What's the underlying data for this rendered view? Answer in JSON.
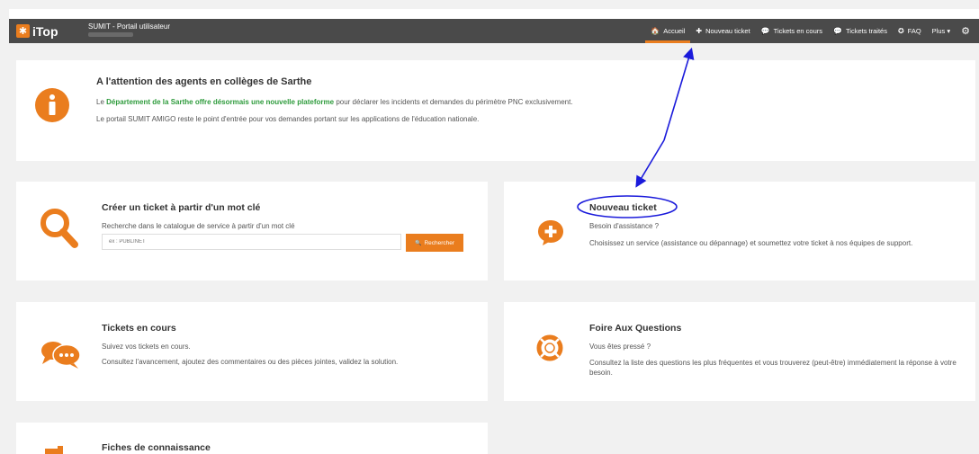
{
  "header": {
    "logo_text": "iTop",
    "portal_title": "SUMIT - Portail utilisateur",
    "nav": [
      {
        "label": "Accueil",
        "icon": "home-icon",
        "glyph": "🏠"
      },
      {
        "label": "Nouveau ticket",
        "icon": "plus-circle-icon",
        "glyph": "✚"
      },
      {
        "label": "Tickets en cours",
        "icon": "comments-icon",
        "glyph": "💬"
      },
      {
        "label": "Tickets traités",
        "icon": "comments-icon",
        "glyph": "💬"
      },
      {
        "label": "FAQ",
        "icon": "lifebuoy-icon",
        "glyph": "✪"
      },
      {
        "label": "Plus ▾",
        "icon": "",
        "glyph": ""
      }
    ],
    "settings_glyph": "⚙"
  },
  "announcement": {
    "title": "A l'attention des agents en collèges de Sarthe",
    "line1_prefix": "Le ",
    "line1_link": "Département de la Sarthe offre désormais une nouvelle plateforme",
    "line1_suffix": " pour déclarer les incidents et demandes du périmètre PNC exclusivement.",
    "line2": "Le portail SUMIT AMIGO reste le point d'entrée pour vos demandes portant sur les applications de l'éducation nationale.",
    "icon_glyph": "i"
  },
  "search_card": {
    "title": "Créer un ticket à partir d'un mot clé",
    "text": "Recherche dans le catalogue de service à partir d'un mot clé",
    "placeholder": "ex : PUBLINET",
    "button_label": "Rechercher",
    "button_glyph": "🔍"
  },
  "new_ticket_card": {
    "title": "Nouveau ticket",
    "subtitle": "Besoin d'assistance ?",
    "text": "Choisissez un service (assistance ou dépannage) et soumettez votre ticket à nos équipes de support."
  },
  "ongoing_card": {
    "title": "Tickets en cours",
    "line1": "Suivez vos tickets en cours.",
    "line2": "Consultez l'avancement, ajoutez des commentaires ou des pièces jointes, validez la solution."
  },
  "faq_card": {
    "title": "Foire Aux Questions",
    "subtitle": "Vous êtes pressé ?",
    "text": "Consultez la liste des questions les plus fréquentes et vous trouverez (peut-être) immédiatement la réponse à votre besoin."
  },
  "knowledge_card": {
    "title": "Fiches de connaissance"
  },
  "colors": {
    "accent": "#ea7d1e",
    "header_bg": "#4a4a4a",
    "link_green": "#2e9b3c",
    "annotation_blue": "#1a1adb"
  }
}
